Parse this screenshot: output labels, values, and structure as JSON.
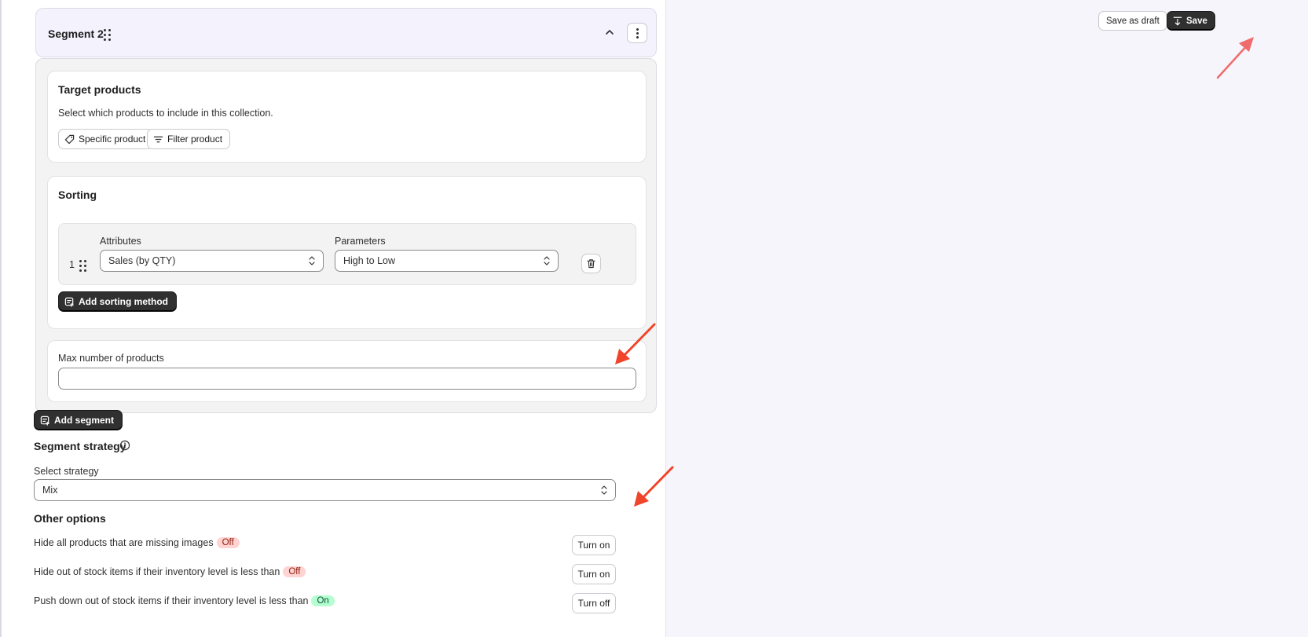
{
  "segment": {
    "title": "Segment 2",
    "target_products": {
      "title": "Target products",
      "description": "Select which products to include in this collection.",
      "specific_product_label": "Specific product",
      "filter_product_label": "Filter product"
    },
    "sorting": {
      "title": "Sorting",
      "rows": [
        {
          "index": "1",
          "attributes_label": "Attributes",
          "attributes_value": "Sales (by QTY)",
          "parameters_label": "Parameters",
          "parameters_value": "High to Low"
        }
      ],
      "add_sorting_label": "Add sorting method"
    },
    "max_products": {
      "label": "Max number of products",
      "value": ""
    }
  },
  "add_segment_label": "Add segment",
  "segment_strategy": {
    "title": "Segment strategy",
    "select_label": "Select strategy",
    "select_value": "Mix"
  },
  "other_options": {
    "title": "Other options",
    "items": [
      {
        "label": "Hide all products that are missing images",
        "status": "Off",
        "button": "Turn on"
      },
      {
        "label": "Hide out of stock items if their inventory level is less than",
        "status": "Off",
        "button": "Turn on"
      },
      {
        "label": "Push down out of stock items if their inventory level is less than",
        "status": "On",
        "button": "Turn off"
      }
    ]
  },
  "toolbar": {
    "save_draft_label": "Save as draft",
    "save_label": "Save"
  },
  "colors": {
    "primary_button": "#303030",
    "annotation_arrow": "#f0452a",
    "badge_off_bg": "#fed3d1",
    "badge_on_bg": "#b4fed2",
    "segment_header_bg": "#f3f2fd",
    "right_panel_bg": "#f6f5fc"
  },
  "icons": [
    "drag-handle-icon",
    "chevron-up-icon",
    "more-vertical-icon",
    "tag-icon",
    "filter-icon",
    "select-updown-icon",
    "trash-icon",
    "add-icon",
    "info-icon",
    "save-icon"
  ]
}
